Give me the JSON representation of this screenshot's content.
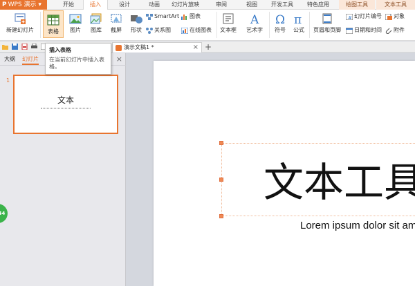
{
  "app": {
    "name": "WPS 演示"
  },
  "tabs": [
    "开始",
    "插入",
    "设计",
    "动画",
    "幻灯片放映",
    "审阅",
    "视图",
    "开发工具",
    "特色应用",
    "绘图工具",
    "文本工具"
  ],
  "ribbon": {
    "new_slide": "新建幻灯片",
    "table": "表格",
    "picture": "图片",
    "gallery": "图库",
    "screenshot": "截屏",
    "shapes": "形状",
    "smartart": "SmartArt",
    "chart": "图表",
    "relation_map": "关系图",
    "online_chart": "在线图表",
    "textbox": "文本框",
    "wordart": "艺术字",
    "symbol": "符号",
    "formula": "公式",
    "header_footer": "页眉和页脚",
    "slide_number": "幻灯片编号",
    "object": "对象",
    "datetime": "日期和时间",
    "attachment": "附件"
  },
  "tooltip": {
    "title": "插入表格",
    "desc": "在当前幻灯片中插入表格。"
  },
  "doc_tab": {
    "title": "演示文稿1 *",
    "close": "×",
    "new": "+"
  },
  "panel": {
    "tab_outline": "大纲",
    "tab_slides": "幻灯片",
    "close": "×",
    "slide_number": "1",
    "thumb_title": "文本"
  },
  "float_button": "44",
  "slide": {
    "title": "文本工具",
    "subtitle": "Lorem ipsum dolor sit am"
  },
  "colors": {
    "accent": "#e8742f",
    "active_button": "#fde5c8",
    "context_tab": "#fbe7d9",
    "handle": "#f08a54"
  }
}
